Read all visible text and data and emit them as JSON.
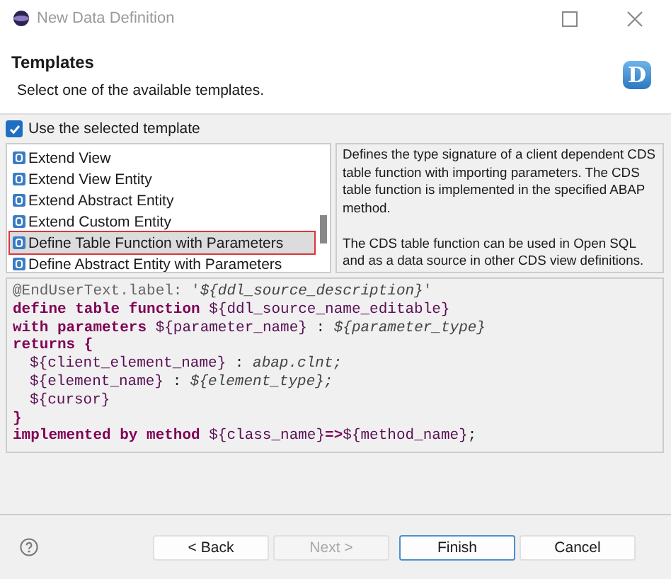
{
  "window": {
    "title": "New Data Definition"
  },
  "header": {
    "title": "Templates",
    "subtitle": "Select one of the available templates.",
    "logo_letter": "D"
  },
  "use_template": {
    "label": "Use the selected template",
    "checked": true
  },
  "templates": [
    {
      "label": "Extend View",
      "selected": false
    },
    {
      "label": "Extend View Entity",
      "selected": false
    },
    {
      "label": "Extend Abstract Entity",
      "selected": false
    },
    {
      "label": "Extend Custom Entity",
      "selected": false
    },
    {
      "label": "Define Table Function with Parameters",
      "selected": true
    },
    {
      "label": "Define Abstract Entity with Parameters",
      "selected": false
    }
  ],
  "description": [
    "Defines the type signature of a client dependent CDS table function with importing parameters. The CDS table function is implemented in the specified ABAP method.",
    "The CDS table function can be used in Open SQL and as a data source in other CDS view definitions."
  ],
  "code": [
    [
      {
        "kind": "annotation",
        "text": "@EndUserText.label: '"
      },
      {
        "kind": "italic",
        "text": "${ddl_source_description}"
      },
      {
        "kind": "annotation",
        "text": "'"
      }
    ],
    [
      {
        "kind": "keyword",
        "text": "define table function "
      },
      {
        "kind": "var",
        "text": "${ddl_source_name_editable}"
      }
    ],
    [
      {
        "kind": "keyword",
        "text": "with parameters "
      },
      {
        "kind": "var",
        "text": "${parameter_name}"
      },
      {
        "kind": "plain",
        "text": " : "
      },
      {
        "kind": "italic",
        "text": "${parameter_type}"
      }
    ],
    [
      {
        "kind": "keyword",
        "text": "returns {"
      }
    ],
    [
      {
        "kind": "indent"
      },
      {
        "kind": "var",
        "text": "${client_element_name}"
      },
      {
        "kind": "plain",
        "text": " : "
      },
      {
        "kind": "italic",
        "text": "abap.clnt;"
      }
    ],
    [
      {
        "kind": "indent"
      },
      {
        "kind": "var",
        "text": "${element_name}"
      },
      {
        "kind": "plain",
        "text": " : "
      },
      {
        "kind": "italic",
        "text": "${element_type};"
      }
    ],
    [
      {
        "kind": "indent"
      },
      {
        "kind": "var",
        "text": "${cursor}"
      }
    ],
    [
      {
        "kind": "keyword",
        "text": "}"
      }
    ],
    [
      {
        "kind": "keyword",
        "text": "implemented by method "
      },
      {
        "kind": "var",
        "text": "${class_name}"
      },
      {
        "kind": "keyword",
        "text": "=>"
      },
      {
        "kind": "var",
        "text": "${method_name}"
      },
      {
        "kind": "plain",
        "text": ";"
      }
    ]
  ],
  "buttons": [
    {
      "label": "< Back",
      "disabled": false,
      "default": false
    },
    {
      "label": "Next >",
      "disabled": true,
      "default": false
    },
    {
      "label": "Finish",
      "disabled": false,
      "default": true
    },
    {
      "label": "Cancel",
      "disabled": false,
      "default": false
    }
  ]
}
